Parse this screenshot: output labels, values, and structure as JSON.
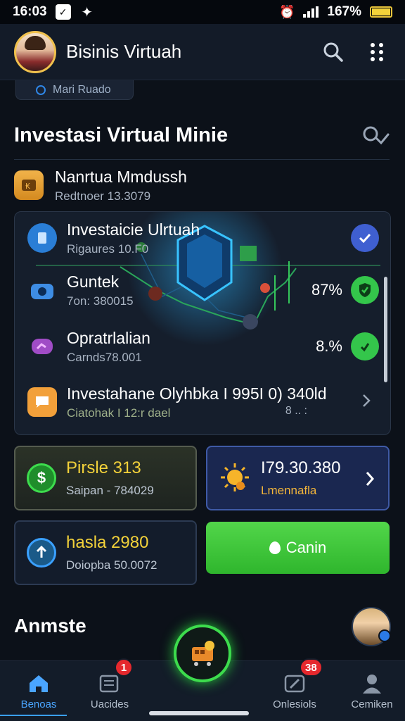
{
  "status": {
    "time": "16:03",
    "battery": "167%"
  },
  "header": {
    "title": "Bisinis Virtuah"
  },
  "top_chip": {
    "label": "Mari Ruado"
  },
  "section": {
    "title": "Investasi Virtual Minie"
  },
  "first_item": {
    "title": "Nanrtua Mmdussh",
    "subtitle": "Redtnoer 13.3079"
  },
  "panel_items": [
    {
      "title": "Investaicie Ulrtuah",
      "subtitle": "Rigaures 10.F0"
    },
    {
      "title": "Guntek",
      "subtitle": "7on: 380015",
      "percent": "87%"
    },
    {
      "title": "Opratrlalian",
      "subtitle": "Carnds78.001",
      "percent": "8.%"
    },
    {
      "title": "Investahane Olyhbka I 995I 0) 340ld",
      "subtitle": "Ciatohak I 12:r dael",
      "trailing": "8 .. :"
    }
  ],
  "cards": {
    "card1": {
      "title": "Pirsle 313",
      "subtitle": "Saipan - 784029"
    },
    "card2": {
      "title": "I79.30.380",
      "subtitle": "Lmennafla"
    },
    "card3": {
      "title": "hasla 2980",
      "subtitle": "Doiopba 50.0072"
    },
    "card4": {
      "label": "Canin"
    }
  },
  "bottom": {
    "heading": "Anmste"
  },
  "nav": {
    "items": [
      {
        "label": "Benoas"
      },
      {
        "label": "Uacides",
        "badge": "1"
      },
      {
        "label": "Onlesiols",
        "badge": "38"
      },
      {
        "label": "Cemiken"
      }
    ]
  },
  "colors": {
    "accent_green": "#3ddc4d",
    "accent_blue": "#3aa0ff",
    "badge_red": "#e5282d"
  }
}
